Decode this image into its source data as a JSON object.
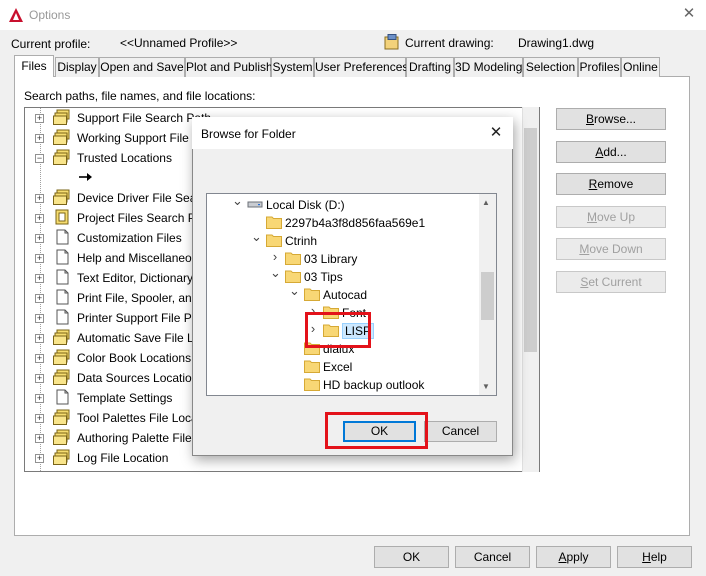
{
  "window": {
    "title": "Options",
    "close_glyph": "✕",
    "icon": "autocad-logo-icon",
    "accent_color": "#c8102e"
  },
  "profile": {
    "current_profile_label": "Current profile:",
    "current_profile_value": "<<Unnamed Profile>>",
    "current_drawing_label": "Current drawing:",
    "current_drawing_value": "Drawing1.dwg"
  },
  "tabs": [
    {
      "label": "Files",
      "active": true
    },
    {
      "label": "Display"
    },
    {
      "label": "Open and Save"
    },
    {
      "label": "Plot and Publish"
    },
    {
      "label": "System"
    },
    {
      "label": "User Preferences"
    },
    {
      "label": "Drafting"
    },
    {
      "label": "3D Modeling"
    },
    {
      "label": "Selection"
    },
    {
      "label": "Profiles"
    },
    {
      "label": "Online"
    }
  ],
  "files_tab": {
    "section_label": "Search paths, file names, and file locations:",
    "tree": [
      {
        "label": "Support File Search Path",
        "icon": "folder-stack-icon",
        "expander": "+"
      },
      {
        "label": "Working Support File Search Path",
        "icon": "folder-stack-icon",
        "expander": "+"
      },
      {
        "label": "Trusted Locations",
        "icon": "folder-stack-icon",
        "expander": "−"
      },
      {
        "label": "",
        "icon": "arrow-right-icon",
        "expander": ""
      },
      {
        "label": "Device Driver File Search Path",
        "icon": "folder-stack-icon",
        "expander": "+"
      },
      {
        "label": "Project Files Search Path",
        "icon": "project-folder-icon",
        "expander": "+"
      },
      {
        "label": "Customization Files",
        "icon": "document-icon",
        "expander": "+"
      },
      {
        "label": "Help and Miscellaneous File Names",
        "icon": "document-icon",
        "expander": "+"
      },
      {
        "label": "Text Editor, Dictionary, and Font File Names",
        "icon": "document-icon",
        "expander": "+"
      },
      {
        "label": "Print File, Spooler, and Prolog Section Names",
        "icon": "document-icon",
        "expander": "+"
      },
      {
        "label": "Printer Support File Path",
        "icon": "document-icon",
        "expander": "+"
      },
      {
        "label": "Automatic Save File Location",
        "icon": "folder-stack-icon",
        "expander": "+"
      },
      {
        "label": "Color Book Locations",
        "icon": "folder-stack-icon",
        "expander": "+"
      },
      {
        "label": "Data Sources Location",
        "icon": "folder-stack-icon",
        "expander": "+"
      },
      {
        "label": "Template Settings",
        "icon": "document-icon",
        "expander": "+"
      },
      {
        "label": "Tool Palettes File Locations",
        "icon": "folder-stack-icon",
        "expander": "+"
      },
      {
        "label": "Authoring Palette File Locations",
        "icon": "folder-stack-icon",
        "expander": "+"
      },
      {
        "label": "Log File Location",
        "icon": "folder-stack-icon",
        "expander": "+"
      }
    ],
    "buttons": {
      "browse": "Browse...",
      "add": "Add...",
      "remove": "Remove",
      "move_up": "Move Up",
      "move_down": "Move Down",
      "set_current": "Set Current"
    }
  },
  "footer": {
    "ok": "OK",
    "cancel": "Cancel",
    "apply": "Apply",
    "help": "Help"
  },
  "browse_dialog": {
    "title": "Browse for Folder",
    "close_glyph": "✕",
    "folders": [
      {
        "label": "Local Disk (D:)",
        "depth": 0,
        "chevron": "v",
        "icon": "drive-icon"
      },
      {
        "label": "2297b4a3f8d856faa569e1",
        "depth": 1,
        "chevron": "",
        "icon": "folder-icon"
      },
      {
        "label": "Ctrinh",
        "depth": 1,
        "chevron": "v",
        "icon": "folder-icon"
      },
      {
        "label": "03 Library",
        "depth": 2,
        "chevron": ">",
        "icon": "folder-icon"
      },
      {
        "label": "03 Tips",
        "depth": 2,
        "chevron": "v",
        "icon": "folder-icon"
      },
      {
        "label": "Autocad",
        "depth": 3,
        "chevron": "v",
        "icon": "folder-icon"
      },
      {
        "label": "Font",
        "depth": 4,
        "chevron": ">",
        "icon": "folder-icon"
      },
      {
        "label": "LISP",
        "depth": 4,
        "chevron": ">",
        "icon": "folder-icon",
        "selected": true
      },
      {
        "label": "dialux",
        "depth": 3,
        "chevron": "",
        "icon": "folder-icon"
      },
      {
        "label": "Excel",
        "depth": 3,
        "chevron": "",
        "icon": "folder-icon"
      },
      {
        "label": "HD backup outlook",
        "depth": 3,
        "chevron": "",
        "icon": "folder-icon"
      }
    ],
    "ok": "OK",
    "cancel": "Cancel",
    "highlight_color": "#e3121a"
  }
}
